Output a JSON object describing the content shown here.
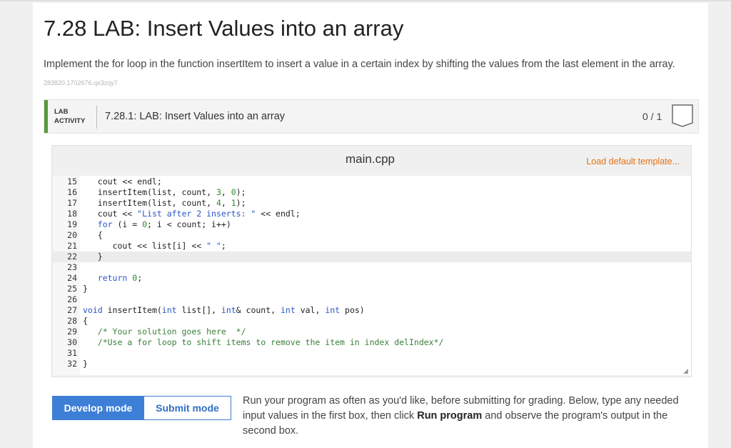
{
  "page_title": "7.28 LAB: Insert Values into an array",
  "description": "Implement the for loop in the function insertItem to insert a value in a certain index by shifting the values from the last element in the array.",
  "hash_id": "283820.1702676.qx3zqy7",
  "lab": {
    "tag_line1": "LAB",
    "tag_line2": "ACTIVITY",
    "name": "7.28.1: LAB: Insert Values into an array",
    "score": "0 / 1"
  },
  "editor": {
    "filename": "main.cpp",
    "load_default": "Load default template...",
    "active_line": 22,
    "lines": [
      {
        "n": "15",
        "code": "   cout << endl;"
      },
      {
        "n": "16",
        "code": "   insertItem(list, count, 3, 0);"
      },
      {
        "n": "17",
        "code": "   insertItem(list, count, 4, 1);"
      },
      {
        "n": "18",
        "code": "   cout << \"List after 2 inserts: \" << endl;"
      },
      {
        "n": "19",
        "code": "   for (i = 0; i < count; i++)"
      },
      {
        "n": "20",
        "code": "   {"
      },
      {
        "n": "21",
        "code": "      cout << list[i] << \" \";"
      },
      {
        "n": "22",
        "code": "   }"
      },
      {
        "n": "23",
        "code": ""
      },
      {
        "n": "24",
        "code": "   return 0;"
      },
      {
        "n": "25",
        "code": "}"
      },
      {
        "n": "26",
        "code": ""
      },
      {
        "n": "27",
        "code": "void insertItem(int list[], int& count, int val, int pos)"
      },
      {
        "n": "28",
        "code": "{"
      },
      {
        "n": "29",
        "code": "   /* Your solution goes here  */"
      },
      {
        "n": "30",
        "code": "   /*Use a for loop to shift items to remove the item in index delIndex*/"
      },
      {
        "n": "31",
        "code": ""
      },
      {
        "n": "32",
        "code": "}"
      }
    ]
  },
  "modes": {
    "develop": "Develop mode",
    "submit": "Submit mode"
  },
  "instructions": {
    "part1": "Run your program as often as you'd like, before submitting for grading. Below, type any needed input values in the first box, then click ",
    "bold": "Run program",
    "part2": " and observe the program's output in the second box."
  }
}
